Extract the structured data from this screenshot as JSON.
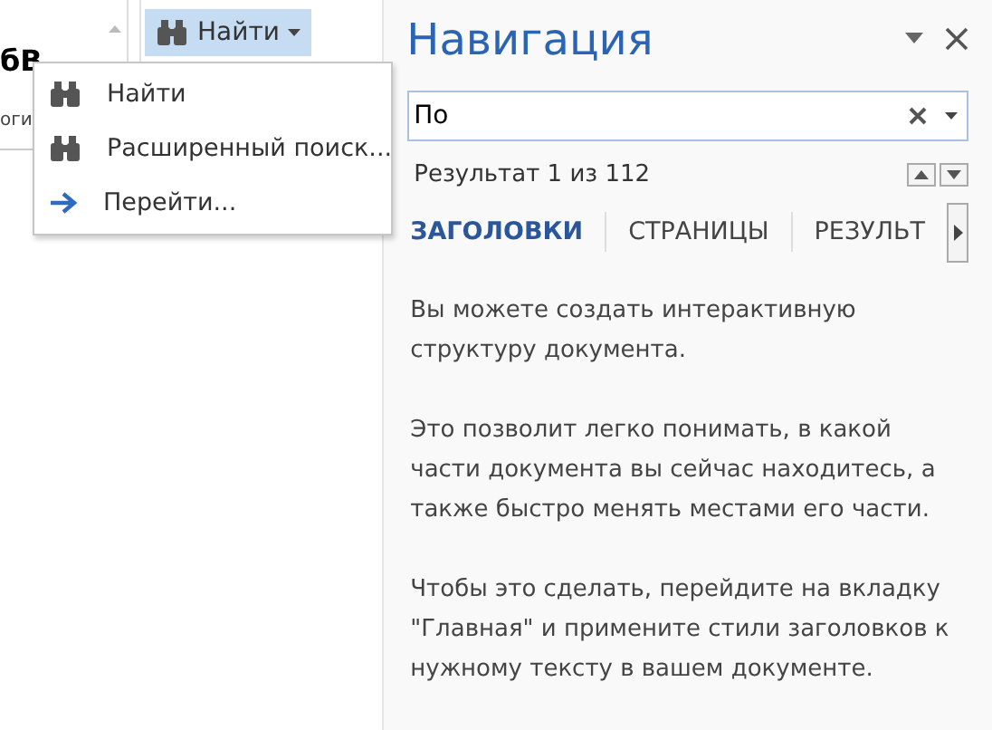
{
  "ribbon": {
    "gallery_fragments": [
      "бВ",
      "оги"
    ],
    "find_button": {
      "label": "Найти",
      "selected": true
    }
  },
  "find_menu": {
    "items": [
      {
        "kind": "binoculars",
        "label": "Найти"
      },
      {
        "kind": "binoculars",
        "label": "Расширенный поиск..."
      },
      {
        "kind": "arrow",
        "label": "Перейти..."
      }
    ]
  },
  "navigation": {
    "title": "Навигация",
    "search": {
      "value": "По"
    },
    "result": "Результат 1 из 112",
    "tabs": [
      {
        "label": "ЗАГОЛОВКИ",
        "selected": true
      },
      {
        "label": "СТРАНИЦЫ",
        "selected": false
      },
      {
        "label": "РЕЗУЛЬТ",
        "selected": false
      }
    ],
    "paragraphs": [
      "Вы можете создать интерактивную структуру документа.",
      "Это позволит легко понимать, в какой части документа вы сейчас находитесь, а также быстро менять местами его части.",
      "Чтобы это сделать, перейдите на вкладку \"Главная\" и примените стили заголовков к нужному тексту в вашем документе."
    ]
  }
}
